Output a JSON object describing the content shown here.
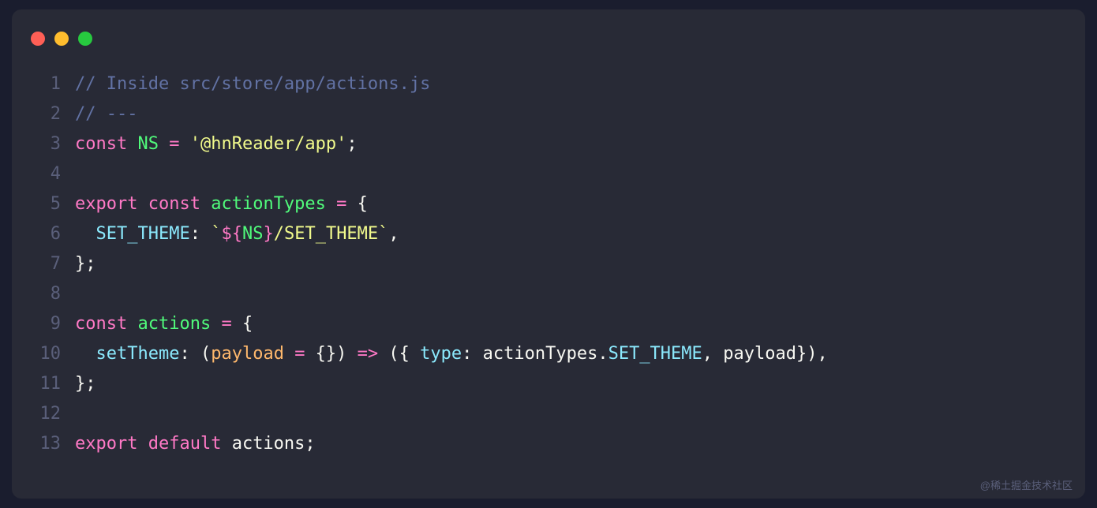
{
  "watermark": "@稀土掘金技术社区",
  "lines": [
    {
      "num": "1",
      "tokens": [
        {
          "cls": "comment",
          "t": "// Inside src/store/app/actions.js"
        }
      ]
    },
    {
      "num": "2",
      "tokens": [
        {
          "cls": "comment",
          "t": "// ---"
        }
      ]
    },
    {
      "num": "3",
      "tokens": [
        {
          "cls": "keyword",
          "t": "const"
        },
        {
          "cls": "plain",
          "t": " "
        },
        {
          "cls": "variable",
          "t": "NS"
        },
        {
          "cls": "plain",
          "t": " "
        },
        {
          "cls": "operator",
          "t": "="
        },
        {
          "cls": "plain",
          "t": " "
        },
        {
          "cls": "string",
          "t": "'@hnReader/app'"
        },
        {
          "cls": "plain",
          "t": ";"
        }
      ]
    },
    {
      "num": "4",
      "tokens": []
    },
    {
      "num": "5",
      "tokens": [
        {
          "cls": "keyword",
          "t": "export"
        },
        {
          "cls": "plain",
          "t": " "
        },
        {
          "cls": "keyword",
          "t": "const"
        },
        {
          "cls": "plain",
          "t": " "
        },
        {
          "cls": "variable",
          "t": "actionTypes"
        },
        {
          "cls": "plain",
          "t": " "
        },
        {
          "cls": "operator",
          "t": "="
        },
        {
          "cls": "plain",
          "t": " {"
        }
      ]
    },
    {
      "num": "6",
      "tokens": [
        {
          "cls": "plain",
          "t": "  "
        },
        {
          "cls": "property",
          "t": "SET_THEME"
        },
        {
          "cls": "plain",
          "t": ": "
        },
        {
          "cls": "string",
          "t": "`"
        },
        {
          "cls": "operator",
          "t": "${"
        },
        {
          "cls": "template-expr",
          "t": "NS"
        },
        {
          "cls": "operator",
          "t": "}"
        },
        {
          "cls": "string",
          "t": "/SET_THEME`"
        },
        {
          "cls": "plain",
          "t": ","
        }
      ]
    },
    {
      "num": "7",
      "tokens": [
        {
          "cls": "plain",
          "t": "};"
        }
      ]
    },
    {
      "num": "8",
      "tokens": []
    },
    {
      "num": "9",
      "tokens": [
        {
          "cls": "keyword",
          "t": "const"
        },
        {
          "cls": "plain",
          "t": " "
        },
        {
          "cls": "variable",
          "t": "actions"
        },
        {
          "cls": "plain",
          "t": " "
        },
        {
          "cls": "operator",
          "t": "="
        },
        {
          "cls": "plain",
          "t": " {"
        }
      ]
    },
    {
      "num": "10",
      "tokens": [
        {
          "cls": "plain",
          "t": "  "
        },
        {
          "cls": "func-name",
          "t": "setTheme"
        },
        {
          "cls": "plain",
          "t": ": ("
        },
        {
          "cls": "param",
          "t": "payload"
        },
        {
          "cls": "plain",
          "t": " "
        },
        {
          "cls": "operator",
          "t": "="
        },
        {
          "cls": "plain",
          "t": " {}) "
        },
        {
          "cls": "arrow",
          "t": "=>"
        },
        {
          "cls": "plain",
          "t": " ({ "
        },
        {
          "cls": "property",
          "t": "type"
        },
        {
          "cls": "plain",
          "t": ": actionTypes."
        },
        {
          "cls": "property",
          "t": "SET_THEME"
        },
        {
          "cls": "plain",
          "t": ", payload}),"
        }
      ]
    },
    {
      "num": "11",
      "tokens": [
        {
          "cls": "plain",
          "t": "};"
        }
      ]
    },
    {
      "num": "12",
      "tokens": []
    },
    {
      "num": "13",
      "tokens": [
        {
          "cls": "keyword",
          "t": "export"
        },
        {
          "cls": "plain",
          "t": " "
        },
        {
          "cls": "keyword",
          "t": "default"
        },
        {
          "cls": "plain",
          "t": " actions;"
        }
      ]
    }
  ]
}
